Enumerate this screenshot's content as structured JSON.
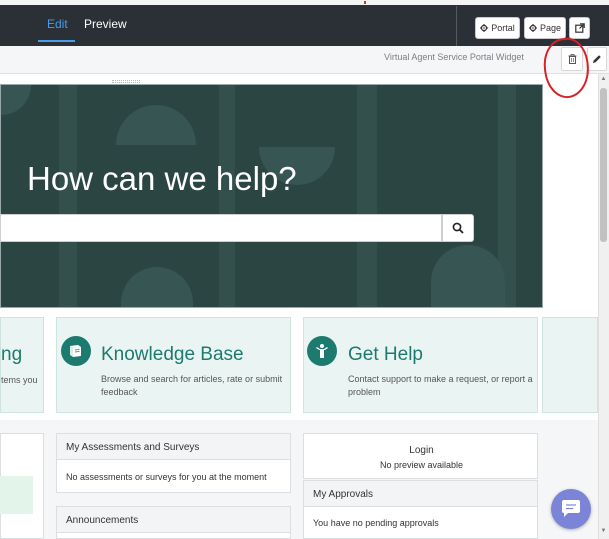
{
  "header": {
    "tabs": [
      {
        "label": "Edit",
        "active": true
      },
      {
        "label": "Preview",
        "active": false
      }
    ],
    "buttons": {
      "portal": "Portal",
      "page": "Page"
    }
  },
  "widget_toolbar": {
    "label": "Virtual Agent Service Portal Widget",
    "delete_icon": "trash-icon",
    "edit_icon": "pencil-icon"
  },
  "hero": {
    "title": "How can we help?",
    "search_placeholder": ""
  },
  "quick_links": [
    {
      "title_partial": "ng",
      "desc_partial": "tems you"
    },
    {
      "title": "Knowledge Base",
      "desc": "Browse and search for articles, rate or submit feedback",
      "icon": "book-icon"
    },
    {
      "title": "Get Help",
      "desc": "Contact support to make a request, or report a problem",
      "icon": "person-icon"
    }
  ],
  "panels": {
    "assessments": {
      "title": "My Assessments and Surveys",
      "text": "No assessments or surveys for you at the moment"
    },
    "announcements": {
      "title": "Announcements"
    },
    "login": {
      "title": "Login",
      "text": "No preview available"
    },
    "approvals": {
      "title": "My Approvals",
      "text": "You have no pending approvals"
    }
  },
  "colors": {
    "accent": "#1d7a6e",
    "tab_active": "#4a9ce8",
    "header_bg": "#2b3036",
    "hero_bg": "#2b4543",
    "chat_button": "#7b84d6",
    "annotation_red": "#d8222a"
  }
}
